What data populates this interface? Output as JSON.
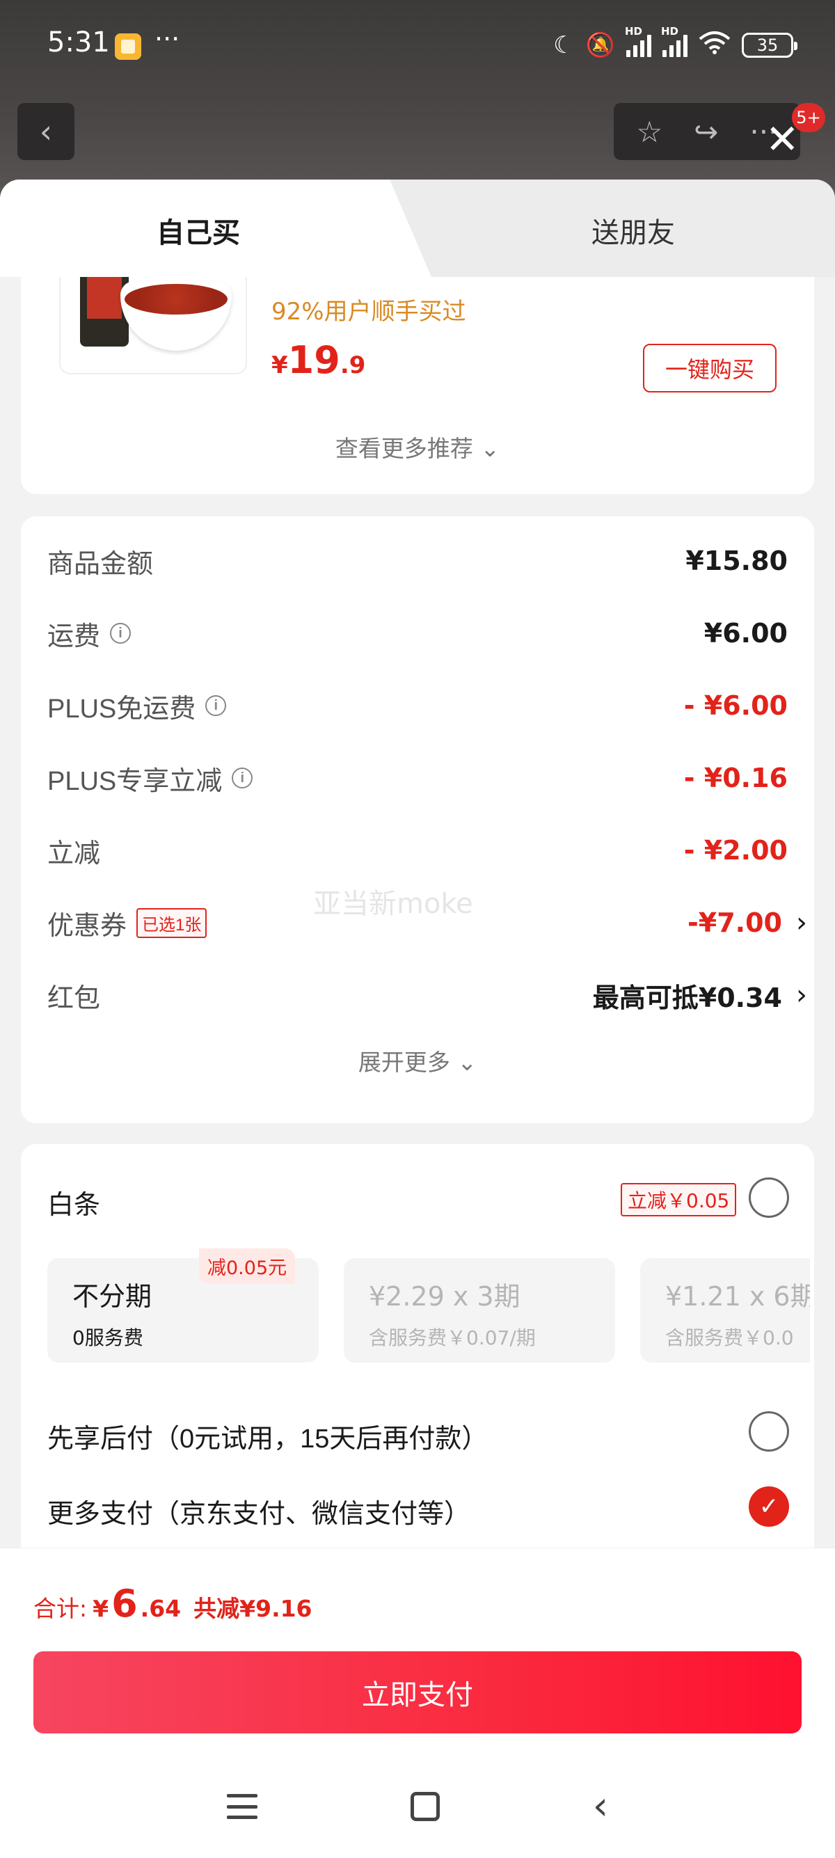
{
  "status_bar": {
    "time": "5:31",
    "dots": "···",
    "battery": "35",
    "hd": "HD"
  },
  "header": {
    "back_icon": "‹",
    "star_icon": "☆",
    "share_icon": "↪",
    "more_icon": "···",
    "badge": "5+",
    "close_icon": "✕"
  },
  "tabs": [
    {
      "label": "自己买",
      "active": true
    },
    {
      "label": "送朋友",
      "active": false
    }
  ],
  "recommendation": {
    "tagline": "92%用户顺手买过",
    "price_symbol": "¥",
    "price_int": "19",
    "price_dec": ".9",
    "buy_label": "一键购买",
    "more_label": "查看更多推荐 ⌄"
  },
  "fees": {
    "rows": [
      {
        "label": "商品金额",
        "value": "¥15.80"
      },
      {
        "label": "运费",
        "value": "¥6.00"
      },
      {
        "label": "PLUS免运费",
        "value": "- ¥6.00"
      },
      {
        "label": "PLUS专享立减",
        "value": "- ¥0.16"
      },
      {
        "label": "立减",
        "value": "- ¥2.00"
      },
      {
        "label": "优惠券",
        "tag": "已选1张",
        "value": "-¥7.00"
      },
      {
        "label": "红包",
        "value": "最高可抵¥0.34"
      }
    ],
    "chevron": "›",
    "info_icon": "i",
    "watermark": "亚当新moke",
    "expand_label": "展开更多 ⌄"
  },
  "payment": {
    "baitiao_title": "白条",
    "baitiao_tag": "立减￥0.05",
    "plans": [
      {
        "title": "不分期",
        "sub": "0服务费",
        "badge": "减0.05元"
      },
      {
        "title": "¥2.29 x 3期",
        "sub": "含服务费￥0.07/期"
      },
      {
        "title": "¥1.21 x 6期",
        "sub": "含服务费￥0.0"
      }
    ],
    "option_later": "先享后付（0元试用，15天后再付款）",
    "option_more": "更多支付（京东支付、微信支付等）",
    "check_icon": "✓"
  },
  "bottom": {
    "total_label": "合计:",
    "total_symbol": "¥",
    "total_int": "6",
    "total_dec": ".64",
    "total_saved": "共减¥9.16",
    "pay_label": "立即支付"
  },
  "colors": {
    "accent": "#e2231a",
    "tagline": "#d98a24"
  }
}
